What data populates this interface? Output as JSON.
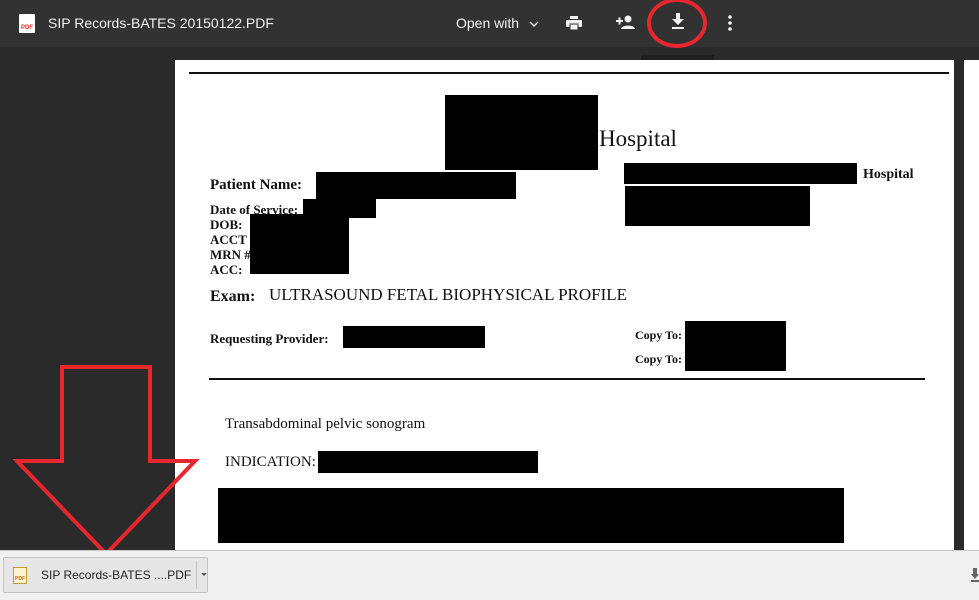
{
  "toolbar": {
    "file_icon_text": "PDF",
    "title": "SIP Records-BATES 20150122.PDF",
    "open_with_label": "Open with",
    "icons": [
      "pdf-icon",
      "print-icon",
      "add-person-icon",
      "download-icon",
      "more-vert-icon"
    ],
    "download_tooltip": "Download",
    "highlight_color": "#e8262e"
  },
  "document": {
    "hospital_label": "Hospital",
    "hospital_label_right": "Hospital",
    "patient_name_label": "Patient Name:",
    "date_of_service_label": "Date of Service:",
    "dob_label": "DOB:",
    "acct_label": "ACCT",
    "mrn_label": "MRN #",
    "acc_label": "ACC:",
    "exam_label": "Exam:",
    "exam_value": "ULTRASOUND FETAL BIOPHYSICAL PROFILE",
    "requesting_provider_label": "Requesting Provider:",
    "copy_to_label_1": "Copy To:",
    "copy_to_label_2": "Copy To:",
    "procedure_text": "Transabdominal pelvic sonogram",
    "indication_label": "INDICATION:"
  },
  "download_shelf": {
    "file_icon_text": "PDF",
    "item_label": "SIP Records-BATES ....PDF"
  }
}
